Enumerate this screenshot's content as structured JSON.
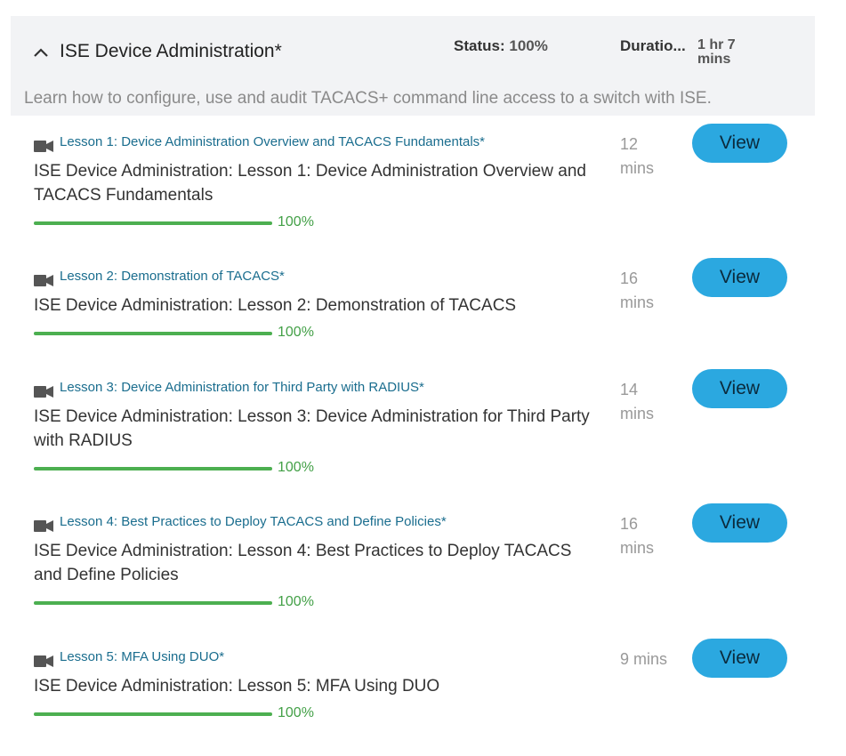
{
  "course": {
    "title": "ISE Device Administration*",
    "status_label": "Status:",
    "status_value": "100%",
    "duration_label": "Duratio...",
    "duration_value": "1 hr 7 mins",
    "description": "Learn how to configure, use and audit TACACS+ command line access to a switch with ISE."
  },
  "colors": {
    "accent": "#2ba8e0",
    "progress": "#4caf50",
    "link": "#1a6d8e",
    "header_bg": "#f2f3f5"
  },
  "lessons": [
    {
      "title": "Lesson 1: Device Administration Overview and TACACS Fundamentals*",
      "description": "ISE Device Administration: Lesson 1: Device Administration Overview and TACACS Fundamentals",
      "progress": 100,
      "progress_label": "100%",
      "duration": "12 mins",
      "button": "View",
      "icon": "video-camera-icon"
    },
    {
      "title": "Lesson 2: Demonstration of TACACS*",
      "description": "ISE Device Administration: Lesson 2: Demonstration of TACACS",
      "progress": 100,
      "progress_label": "100%",
      "duration": "16 mins",
      "button": "View",
      "icon": "video-camera-icon"
    },
    {
      "title": "Lesson 3: Device Administration for Third Party with RADIUS*",
      "description": "ISE Device Administration: Lesson 3: Device Administration for Third Party with RADIUS",
      "progress": 100,
      "progress_label": "100%",
      "duration": "14 mins",
      "button": "View",
      "icon": "video-camera-icon"
    },
    {
      "title": "Lesson 4: Best Practices to Deploy TACACS and Define Policies*",
      "description": "ISE Device Administration: Lesson 4: Best Practices to Deploy TACACS and Define Policies",
      "progress": 100,
      "progress_label": "100%",
      "duration": "16 mins",
      "button": "View",
      "icon": "video-camera-icon"
    },
    {
      "title": "Lesson 5: MFA Using DUO*",
      "description": "ISE Device Administration: Lesson 5: MFA Using DUO",
      "progress": 100,
      "progress_label": "100%",
      "duration": "9 mins",
      "button": "View",
      "icon": "video-camera-icon"
    }
  ]
}
